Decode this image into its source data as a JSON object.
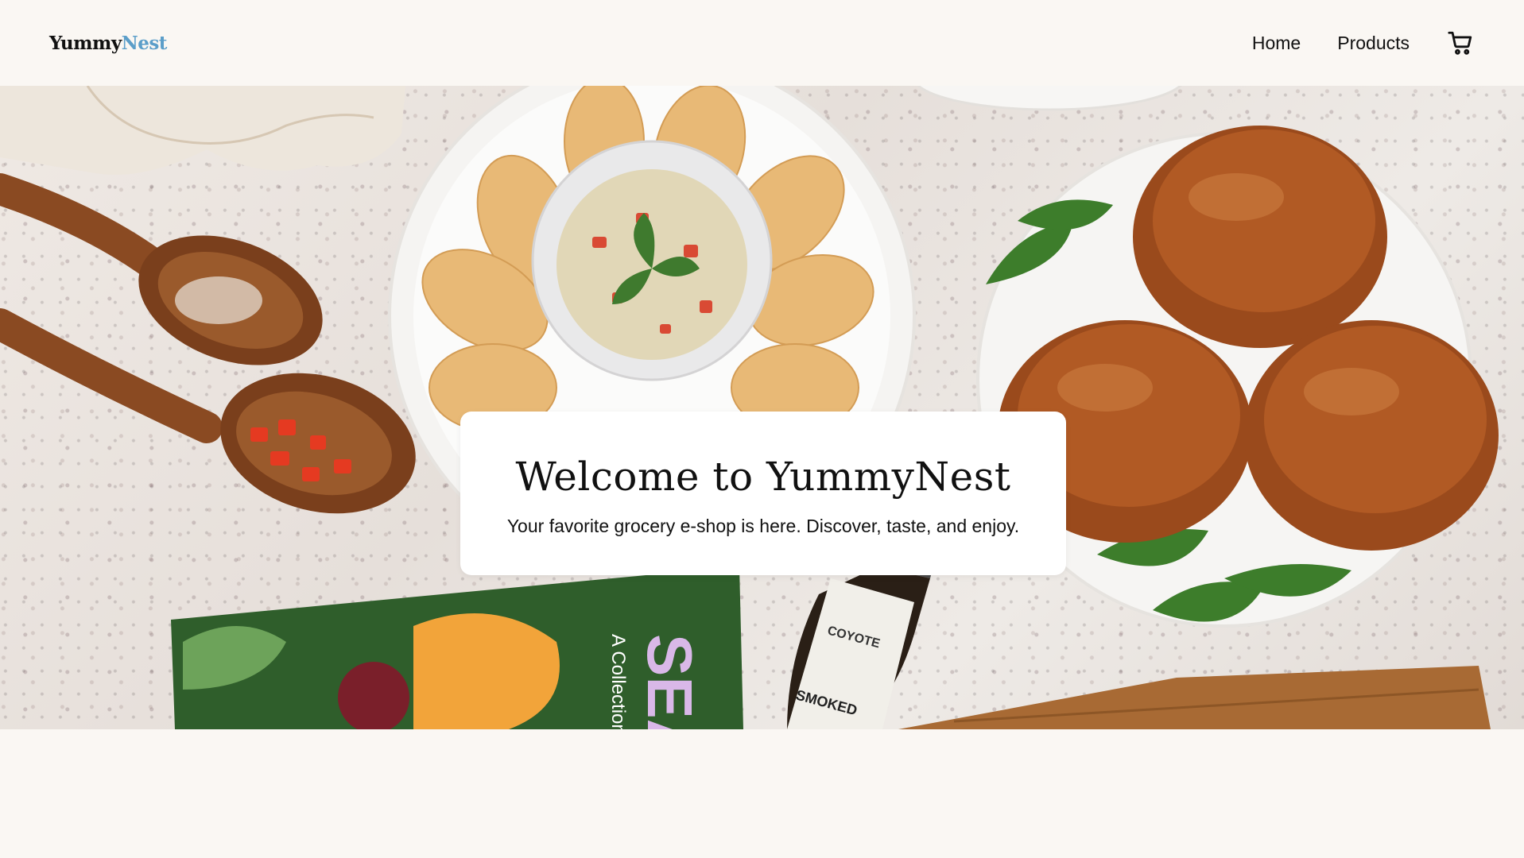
{
  "header": {
    "logo_part1": "Yummy",
    "logo_part2": "Nest",
    "nav": [
      {
        "label": "Home"
      },
      {
        "label": "Products"
      }
    ],
    "cart_icon": "shopping-cart-icon"
  },
  "hero": {
    "title": "Welcome to YummyNest",
    "subtitle": "Your favorite grocery e-shop is here. Discover, taste, and enjoy.",
    "image_description_icons": [
      "food-table-photo"
    ]
  },
  "colors": {
    "background": "#faf7f3",
    "logo_accent": "#5b9ec9",
    "text": "#111111",
    "card": "#ffffff"
  }
}
